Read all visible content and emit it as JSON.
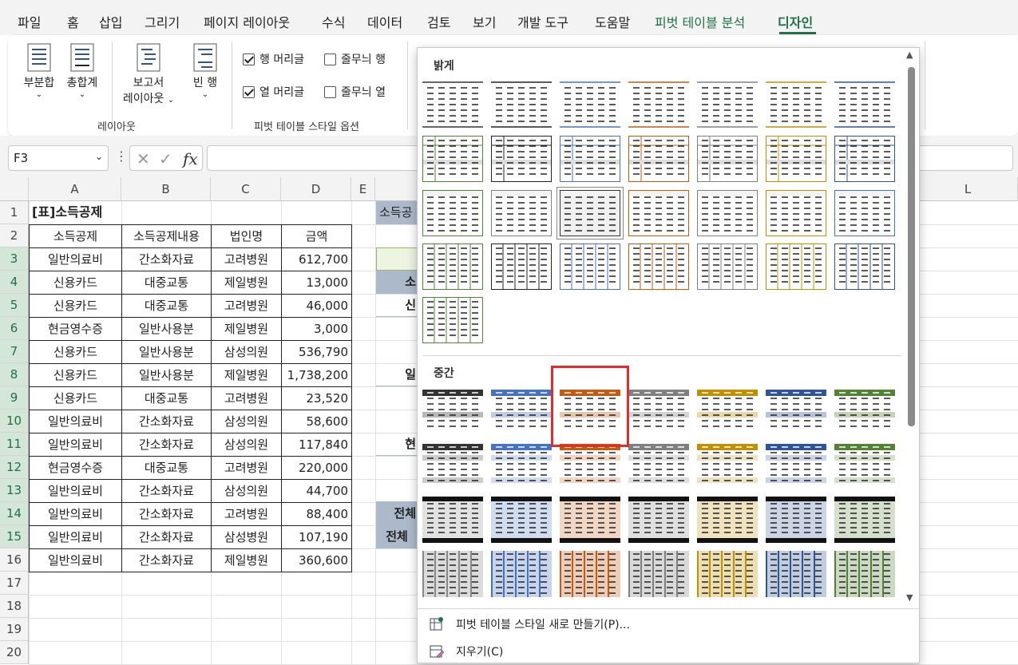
{
  "tabs": [
    "파일",
    "홈",
    "삽입",
    "그리기",
    "페이지 레이아웃",
    "수식",
    "데이터",
    "검토",
    "보기",
    "개발 도구",
    "도움말",
    "피벗 테이블 분석",
    "디자인"
  ],
  "ribbon": {
    "subtotals": "부분합",
    "grandtotals": "총합계",
    "report_layout_1": "보고서",
    "report_layout_2": "레이아웃",
    "blank_rows": "빈 행",
    "group_layout": "레이아웃",
    "row_headers": "행 머리글",
    "banded_rows": "줄무늬 행",
    "col_headers": "열 머리글",
    "banded_cols": "줄무늬 열",
    "row_headers_checked": true,
    "col_headers_checked": true,
    "banded_rows_checked": false,
    "banded_cols_checked": false,
    "group_style_options": "피벗 테이블 스타일 옵션"
  },
  "formula_bar": {
    "name_box": "F3",
    "fx": "fx",
    "formula": ""
  },
  "columns": [
    "A",
    "B",
    "C",
    "D",
    "E",
    "L"
  ],
  "rows": [
    "1",
    "2",
    "3",
    "4",
    "5",
    "6",
    "7",
    "8",
    "9",
    "10",
    "11",
    "12",
    "13",
    "14",
    "15",
    "16",
    "17",
    "18",
    "19",
    "20"
  ],
  "table": {
    "title": "[표]소득공제",
    "headers": [
      "소득공제",
      "소득공제내용",
      "법인명",
      "금액"
    ],
    "rows": [
      [
        "일반의료비",
        "간소화자료",
        "고려병원",
        "612,700"
      ],
      [
        "신용카드",
        "대중교통",
        "제일병원",
        "13,000"
      ],
      [
        "신용카드",
        "대중교통",
        "고려병원",
        "46,000"
      ],
      [
        "현금영수증",
        "일반사용분",
        "제일병원",
        "3,000"
      ],
      [
        "신용카드",
        "일반사용분",
        "삼성의원",
        "536,790"
      ],
      [
        "신용카드",
        "일반사용분",
        "제일병원",
        "1,738,200"
      ],
      [
        "신용카드",
        "대중교통",
        "고려병원",
        "23,520"
      ],
      [
        "일반의료비",
        "간소화자료",
        "삼성의원",
        "58,600"
      ],
      [
        "일반의료비",
        "간소화자료",
        "삼성의원",
        "117,840"
      ],
      [
        "현금영수증",
        "대중교통",
        "고려병원",
        "220,000"
      ],
      [
        "일반의료비",
        "간소화자료",
        "삼성의원",
        "44,700"
      ],
      [
        "일반의료비",
        "간소화자료",
        "고려병원",
        "88,400"
      ],
      [
        "일반의료비",
        "간소화자료",
        "삼성병원",
        "107,190"
      ],
      [
        "일반의료비",
        "간소화자료",
        "제일병원",
        "360,600"
      ]
    ]
  },
  "pivot_partial": {
    "f1": "소득공",
    "r4": "소",
    "r5": "신",
    "r8": "일",
    "r11": "현",
    "r14": "전체",
    "r15": "전체"
  },
  "gallery": {
    "light_label": "밝게",
    "medium_label": "중간",
    "new_style": "피벗 테이블 스타일 새로 만들기(P)...",
    "clear": "지우기(C)",
    "accent_colors": [
      "#333333",
      "#4472c4",
      "#c55a11",
      "#808080",
      "#bf9000",
      "#2f5597",
      "#548235"
    ]
  }
}
